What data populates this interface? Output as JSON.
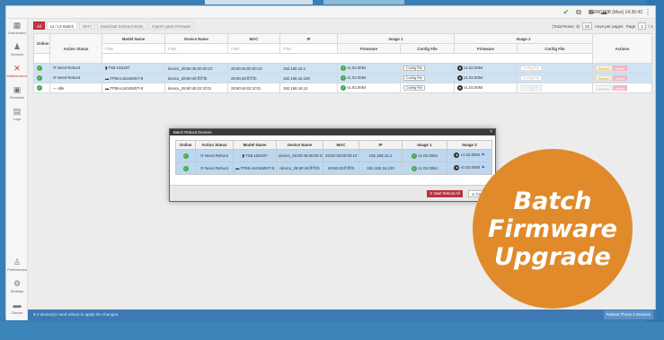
{
  "topbar": {
    "datetime": "2024/07/08 (Mon) 14:36:42",
    "icons": [
      "check-circle-icon",
      "network-icon",
      "globe-icon",
      "cloud-icon"
    ]
  },
  "sidebar": {
    "items": [
      {
        "label": "Dashboard",
        "icon": "dashboard-icon",
        "glyph": "▦"
      },
      {
        "label": "Devices",
        "icon": "devices-icon",
        "glyph": "♟"
      },
      {
        "label": "Maintenance",
        "icon": "tools-icon",
        "glyph": "✕",
        "active": true
      },
      {
        "label": "Schedule",
        "icon": "calendar-icon",
        "glyph": "▣"
      },
      {
        "label": "Logs",
        "icon": "logs-icon",
        "glyph": "▤"
      }
    ],
    "bottom": [
      {
        "label": "Preferences",
        "icon": "lightbulb-icon",
        "glyph": "♙"
      },
      {
        "label": "Settings",
        "icon": "gear-icon",
        "glyph": "⚙"
      },
      {
        "label": "Device",
        "icon": "device-icon",
        "glyph": "▬"
      }
    ]
  },
  "toolbar": {
    "tabs": [
      "All",
      "L2 / L3 Switch",
      "Wi-Fi"
    ],
    "actions": [
      "Download Selected Items",
      "Import Latest Firmware"
    ]
  },
  "pager": {
    "total_rows": "(Total Rows: 3)",
    "per_page_value": "20",
    "per_page_label": "rows per pages",
    "page_label": "Page",
    "page_value": "1",
    "page_of": "/ 1"
  },
  "table": {
    "headers": {
      "online": "Online",
      "action_status": "Action Status",
      "model_name": "Model Name",
      "device_name": "Device Name",
      "mac": "MAC",
      "ip": "IP",
      "image1": "Image 1",
      "image2": "Image 2",
      "firmware": "Firmware",
      "config_file": "Config File",
      "actions": "Actions"
    },
    "filter_placeholder": "Filter",
    "rows": [
      {
        "status": "Need Reboot",
        "model": "TS5-L5618T",
        "device_name": "device_28:60:46:00:00:10",
        "mac": "28:60:46:00:00:10",
        "ip": "192.168.16.1",
        "fw1": "v1.02.0064",
        "cfg1": "Config File",
        "fw2": "v1.02.0064",
        "cfg2": "Config File",
        "selected": true
      },
      {
        "status": "Need Reboot",
        "model": "TP55-L5416MGT-8",
        "device_name": "device_28:60:46:ff:ff:f0",
        "mac": "28:60:46:ff:ff:f0",
        "ip": "192.168.16.100",
        "fw1": "v1.02.0064",
        "cfg1": "Config File",
        "fw2": "v1.02.0064",
        "cfg2": "Config File",
        "selected": true
      },
      {
        "status": "Idle",
        "model": "TP55-L5416MGT-8",
        "device_name": "device_28:60:46:02:1f:01",
        "mac": "28:60:46:02:1f:01",
        "ip": "192.168.16.12",
        "fw1": "v1.02.0064",
        "cfg1": "Config File",
        "fw2": "v1.02.0064",
        "cfg2": "Config File",
        "selected": false
      }
    ],
    "row_actions": [
      "Reboot",
      "Delete"
    ]
  },
  "dialog": {
    "title": "Batch Reboot Devices",
    "headers": [
      "Online",
      "Action Status",
      "Model Name",
      "Device Name",
      "MAC",
      "IP",
      "Image 1",
      "Image 2"
    ],
    "rows": [
      {
        "status": "Need Reboot",
        "model": "TS5-L5618T",
        "device_name": "device_28:60:46:00:00:10",
        "mac": "28:60:46:00:00:10",
        "ip": "192.168.16.1",
        "img1": "v1.02.0064",
        "img2": "v1.02.0064"
      },
      {
        "status": "Need Reboot",
        "model": "TP55-L5416MGT-8",
        "device_name": "device_28:60:46:ff:ff:f0",
        "mac": "28:60:46:ff:ff:f0",
        "ip": "192.168.16.100",
        "img1": "v1.02.0064",
        "img2": "v1.02.0064"
      }
    ],
    "start_button": "Start Reboot All",
    "cancel_button": "Cancel"
  },
  "statusbar": {
    "message": "2 device(s) need reboot to apply the changes.",
    "right_button": "Reboot These 2 Devices"
  },
  "badge": {
    "line1": "Batch",
    "line2": "Firmware",
    "line3": "Upgrade"
  },
  "colors": {
    "accent_red": "#c4394a",
    "online_green": "#45a84b",
    "badge_orange": "#e08a2b",
    "selected_row": "#cfe3f5"
  }
}
